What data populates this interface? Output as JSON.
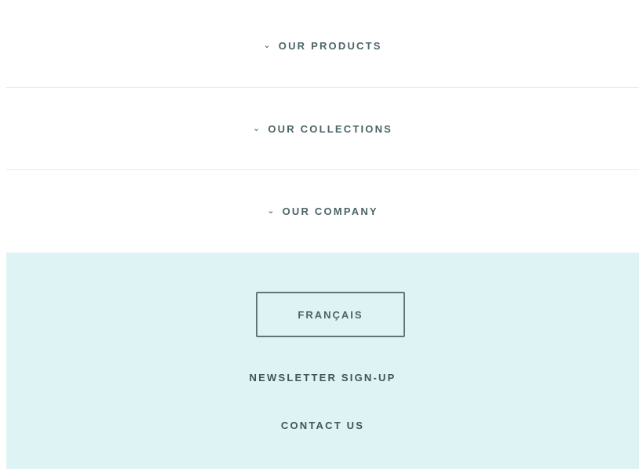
{
  "accordion": {
    "items": [
      {
        "label": "OUR PRODUCTS",
        "chevron": "⌄"
      },
      {
        "label": "OUR COLLECTIONS",
        "chevron": "⌄"
      },
      {
        "label": "OUR COMPANY",
        "chevron": "⌄"
      }
    ]
  },
  "footer": {
    "language_button": "FRANÇAIS",
    "newsletter": "NEWSLETTER SIGN-UP",
    "contact": "CONTACT US"
  },
  "colors": {
    "footer_bg": "#def3f4",
    "text": "#4b6466",
    "divider": "#e4ecec"
  }
}
